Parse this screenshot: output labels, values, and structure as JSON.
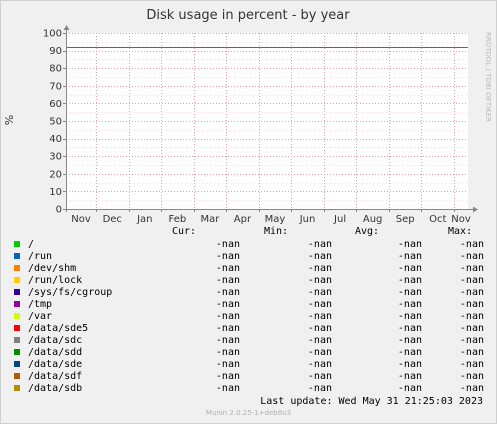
{
  "chart_data": {
    "type": "line",
    "title": "Disk usage in percent - by year",
    "ylabel": "%",
    "xlabel": "",
    "categories": [
      "Nov",
      "Dec",
      "Jan",
      "Feb",
      "Mar",
      "Apr",
      "May",
      "Jun",
      "Jul",
      "Aug",
      "Sep",
      "Oct",
      "Nov"
    ],
    "yticks": [
      "0",
      "10",
      "20",
      "30",
      "40",
      "50",
      "60",
      "70",
      "80",
      "90",
      "100"
    ],
    "ylim": [
      0,
      100
    ],
    "grid": true,
    "watermark": "RRDTOOL / TOBI OETIKER",
    "warning_level": 92,
    "warning_color": "#00aa00",
    "series": [
      {
        "name": "/",
        "color": "#00cc00"
      },
      {
        "name": "/run",
        "color": "#0066b3"
      },
      {
        "name": "/dev/shm",
        "color": "#ff8000"
      },
      {
        "name": "/run/lock",
        "color": "#ffcc00"
      },
      {
        "name": "/sys/fs/cgroup",
        "color": "#330099"
      },
      {
        "name": "/tmp",
        "color": "#990099"
      },
      {
        "name": "/var",
        "color": "#ccff00"
      },
      {
        "name": "/data/sde5",
        "color": "#ff0000"
      },
      {
        "name": "/data/sdc",
        "color": "#808080"
      },
      {
        "name": "/data/sdd",
        "color": "#008f00"
      },
      {
        "name": "/data/sde",
        "color": "#00487d"
      },
      {
        "name": "/data/sdf",
        "color": "#b35a00"
      },
      {
        "name": "/data/sdb",
        "color": "#b38f00"
      }
    ]
  },
  "legend": {
    "headers": {
      "cur": "Cur:",
      "min": "Min:",
      "avg": "Avg:",
      "max": "Max:"
    },
    "rows": [
      {
        "cur": "-nan",
        "min": "-nan",
        "avg": "-nan",
        "max": "-nan"
      },
      {
        "cur": "-nan",
        "min": "-nan",
        "avg": "-nan",
        "max": "-nan"
      },
      {
        "cur": "-nan",
        "min": "-nan",
        "avg": "-nan",
        "max": "-nan"
      },
      {
        "cur": "-nan",
        "min": "-nan",
        "avg": "-nan",
        "max": "-nan"
      },
      {
        "cur": "-nan",
        "min": "-nan",
        "avg": "-nan",
        "max": "-nan"
      },
      {
        "cur": "-nan",
        "min": "-nan",
        "avg": "-nan",
        "max": "-nan"
      },
      {
        "cur": "-nan",
        "min": "-nan",
        "avg": "-nan",
        "max": "-nan"
      },
      {
        "cur": "-nan",
        "min": "-nan",
        "avg": "-nan",
        "max": "-nan"
      },
      {
        "cur": "-nan",
        "min": "-nan",
        "avg": "-nan",
        "max": "-nan"
      },
      {
        "cur": "-nan",
        "min": "-nan",
        "avg": "-nan",
        "max": "-nan"
      },
      {
        "cur": "-nan",
        "min": "-nan",
        "avg": "-nan",
        "max": "-nan"
      },
      {
        "cur": "-nan",
        "min": "-nan",
        "avg": "-nan",
        "max": "-nan"
      },
      {
        "cur": "-nan",
        "min": "-nan",
        "avg": "-nan",
        "max": "-nan"
      }
    ]
  },
  "last_update": "Last update:  Wed May 31 21:25:03 2023",
  "footer": "Munin 2.0.25-1+deb8u3"
}
